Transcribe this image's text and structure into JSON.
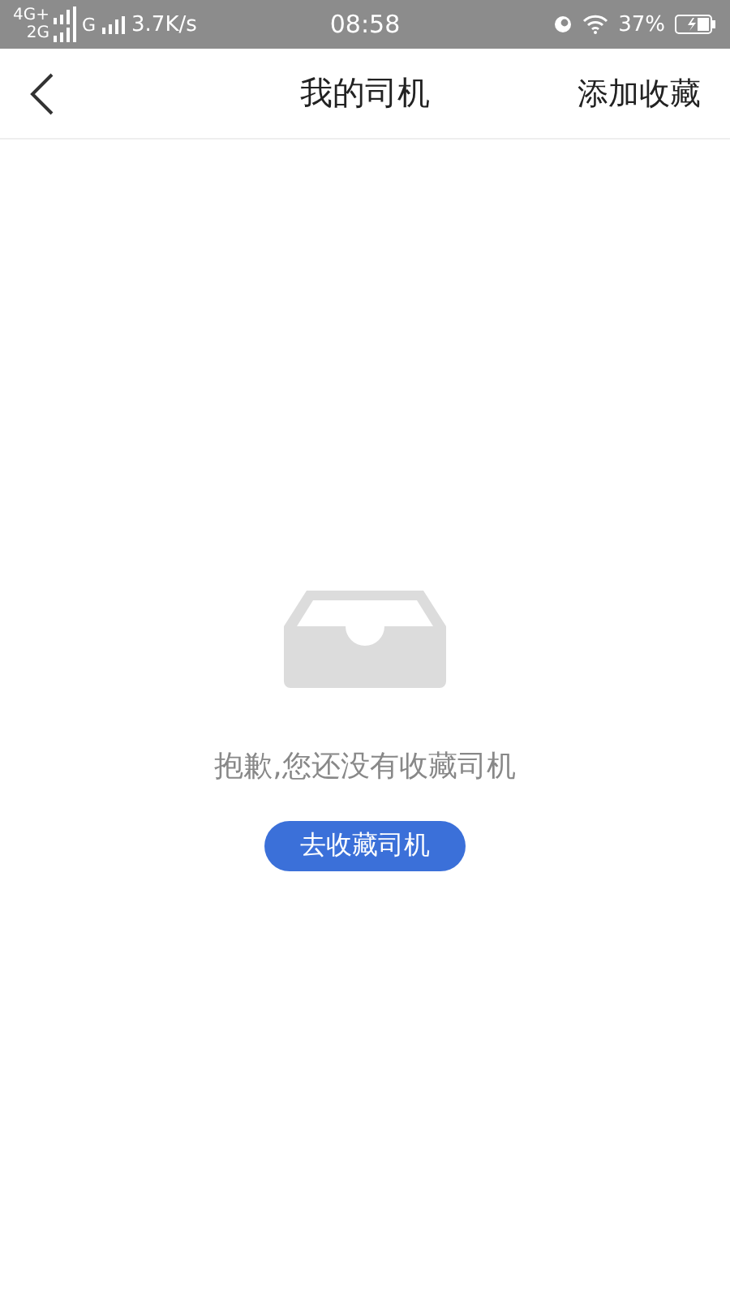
{
  "status_bar": {
    "network_1": "4G+",
    "network_2": "2G",
    "network_3": "G",
    "speed": "3.7K/s",
    "time": "08:58",
    "battery": "37%"
  },
  "nav": {
    "title": "我的司机",
    "action": "添加收藏"
  },
  "empty_state": {
    "message": "抱歉,您还没有收藏司机",
    "button": "去收藏司机"
  }
}
